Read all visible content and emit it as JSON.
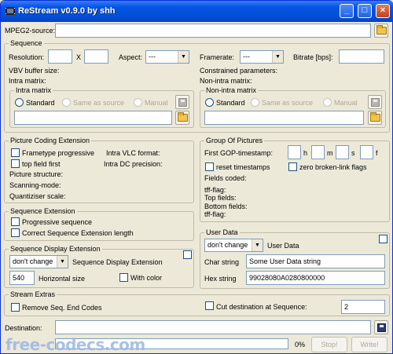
{
  "window": {
    "title": "ReStream v0.9.0 by shh",
    "minimize": "_",
    "maximize": "□",
    "close": "×"
  },
  "mpeg2": {
    "label": "MPEG2-source:",
    "value": ""
  },
  "sequence": {
    "group": "Sequence",
    "resolution": "Resolution:",
    "x": "X",
    "width": "",
    "height": "",
    "aspect": "Aspect:",
    "aspect_value": "---",
    "framerate": "Framerate:",
    "framerate_value": "---",
    "bitrate": "Bitrate [bps]:",
    "bitrate_value": "",
    "vbv": "VBV buffer size:",
    "constrained": "Constrained parameters:",
    "intra_matrix_text": "Intra matrix:",
    "non_intra_matrix_text": "Non-intra matrix:",
    "intra_matrix": {
      "group": "Intra matrix",
      "standard": "Standard",
      "same": "Same as source",
      "manual": "Manual",
      "path": ""
    },
    "non_intra_matrix": {
      "group": "Non-intra matrix",
      "standard": "Standard",
      "same": "Same as source",
      "manual": "Manual",
      "path": ""
    }
  },
  "pce": {
    "group": "Picture Coding Extension",
    "frametype": "Frametype progressive",
    "intra_vlc": "Intra VLC format:",
    "top_field_first": "top field first",
    "intra_dc": "Intra DC precision:",
    "picture_structure": "Picture structure:",
    "scanning_mode": "Scanning-mode:",
    "quantiser": "Quantiziser scale:"
  },
  "gop": {
    "group": "Group Of Pictures",
    "first_gop": "First GOP-timestamp:",
    "h": "h",
    "m": "m",
    "s": "s",
    "f": "f",
    "reset": "reset timestamps",
    "zero": "zero broken-link flags",
    "fields_coded": "Fields coded:",
    "tff": "tff-flag:",
    "top_fields": "Top fields:",
    "bottom_fields": "Bottom fields:",
    "tff2": "tff-flag:"
  },
  "seq_ext": {
    "group": "Sequence Extension",
    "progressive": "Progressive sequence",
    "correct": "Correct Sequence Extension length"
  },
  "sde": {
    "group": "Sequence Display Extension",
    "mode": "don't change",
    "label": "Sequence Display Extension",
    "hsize": "540",
    "hsize_label": "Horizontal size",
    "with_color": "With color"
  },
  "user_data": {
    "group": "User Data",
    "mode": "don't change",
    "label": "User Data",
    "char_label": "Char string",
    "char_value": "Some User Data string",
    "hex_label": "Hex string",
    "hex_value": "99028080A0280800000"
  },
  "stream_extras": {
    "group": "Stream Extras",
    "remove": "Remove Seq. End Codes",
    "cut": "Cut destination at Sequence:",
    "cut_value": "2"
  },
  "destination": {
    "label": "Destination:",
    "value": "",
    "progress": 0,
    "percent": "0%",
    "stop": "Stop!",
    "write": "Write!"
  },
  "watermark": "free-codecs.com"
}
